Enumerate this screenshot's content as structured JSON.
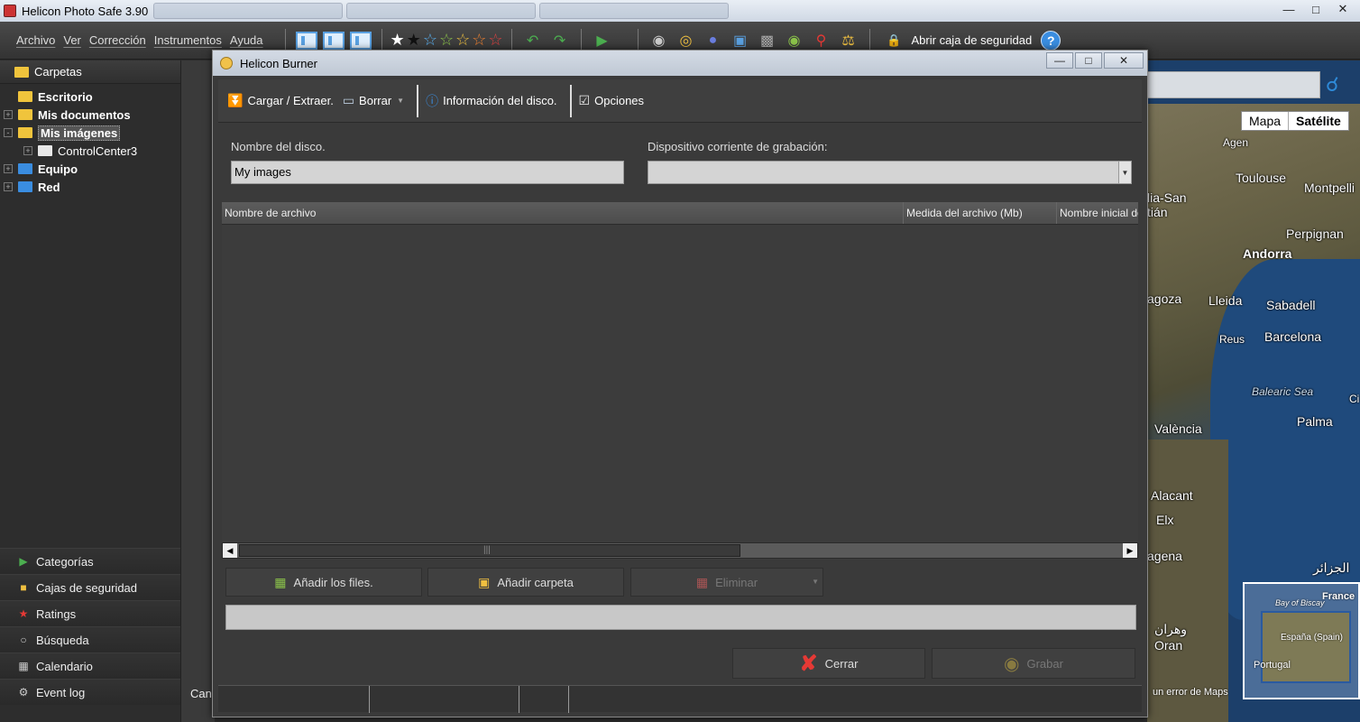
{
  "app": {
    "title": "Helicon Photo Safe 3.90"
  },
  "menu": [
    "Archivo",
    "Ver",
    "Corrección",
    "Instrumentos",
    "Ayuda"
  ],
  "toolbar": {
    "lock_label": "Abrir caja de seguridad",
    "help_label": "?"
  },
  "sidebar": {
    "header": "Carpetas",
    "tree": [
      {
        "label": "Escritorio",
        "bold": true,
        "indent": 0,
        "expander": ""
      },
      {
        "label": "Mis documentos",
        "bold": true,
        "indent": 0,
        "expander": "+"
      },
      {
        "label": "Mis imágenes",
        "bold": true,
        "indent": 0,
        "expander": "-",
        "selected": true
      },
      {
        "label": "ControlCenter3",
        "bold": false,
        "indent": 1,
        "expander": "+"
      },
      {
        "label": "Equipo",
        "bold": true,
        "indent": 0,
        "expander": "+"
      },
      {
        "label": "Red",
        "bold": true,
        "indent": 0,
        "expander": "+"
      }
    ],
    "bottom_nav": [
      "Categorías",
      "Cajas de seguridad",
      "Ratings",
      "Búsqueda",
      "Calendario",
      "Event log"
    ]
  },
  "midstrip": {
    "text": "Can"
  },
  "map": {
    "type_options": [
      "Mapa",
      "Satélite"
    ],
    "cities": [
      "Agen",
      "Toulouse",
      "Montpelli",
      "lia-San",
      "tián",
      "Perpignan",
      "Andorra",
      "agoza",
      "Lleida",
      "Sabadell",
      "Reus",
      "Barcelona",
      "Balearic Sea",
      "Ci",
      "València",
      "Palma",
      "Alacant",
      "Elx",
      "agena",
      "الجزائر",
      "وهران",
      "Oran"
    ],
    "inset_labels": [
      "France",
      "Bay of Biscay",
      "España (Spain)",
      "Portugal"
    ],
    "report": "un error de Maps"
  },
  "dialog": {
    "title": "Helicon Burner",
    "toolbar": {
      "load": "Cargar / Extraer.",
      "erase": "Borrar",
      "disk_info": "Información del disco.",
      "options": "Opciones"
    },
    "disk_name_label": "Nombre del disco.",
    "disk_name_value": "My images",
    "device_label": "Dispositivo corriente de grabación:",
    "device_value": "",
    "columns": [
      "Nombre de archivo",
      "Medida del archivo (Mb)",
      "Nombre inicial de"
    ],
    "buttons": {
      "add_files": "Añadir los files.",
      "add_folder": "Añadir carpeta",
      "delete": "Eliminar",
      "close": "Cerrar",
      "burn": "Grabar"
    }
  },
  "colors": {
    "accent": "#3a8de0",
    "folder": "#f0c43c"
  }
}
